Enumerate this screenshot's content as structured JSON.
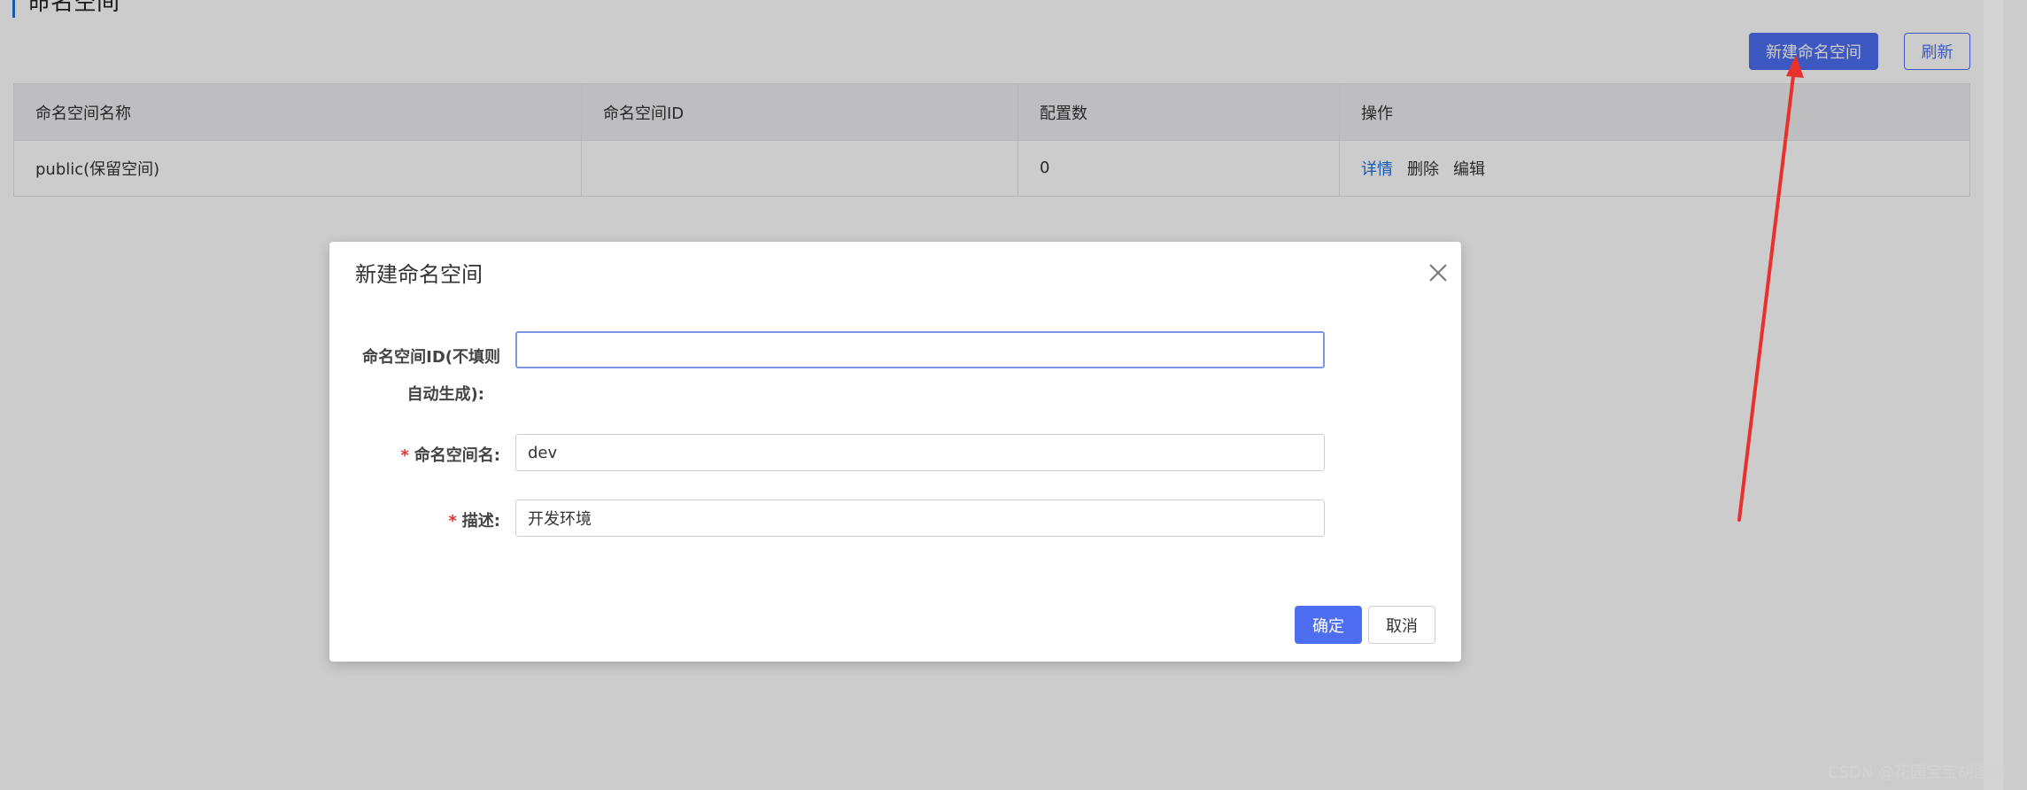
{
  "page": {
    "title": "命名空间",
    "new_namespace_button": "新建命名空间",
    "refresh_button": "刷新"
  },
  "table": {
    "columns": [
      "命名空间名称",
      "命名空间ID",
      "配置数",
      "操作"
    ],
    "rows": [
      {
        "name": "public(保留空间)",
        "id": "",
        "config_count": "0",
        "actions": [
          "详情",
          "删除",
          "编辑"
        ]
      }
    ]
  },
  "modal": {
    "title": "新建命名空间",
    "fields": [
      {
        "label_line1": "命名空间ID(不填则",
        "label_line2": "自动生成):",
        "value": "",
        "required": false
      },
      {
        "label": "命名空间名:",
        "value": "dev",
        "required": true
      },
      {
        "label": "描述:",
        "value": "开发环境",
        "required": true
      }
    ],
    "required_mark": "*",
    "confirm_button": "确定",
    "cancel_button": "取消",
    "close_icon": "close-icon"
  },
  "watermark": "CSDN @花园宝宝胡图图",
  "colors": {
    "primary": "#4e6ef2",
    "link": "#1e6fd9",
    "required": "#e5302b",
    "arrow": "#e8302c"
  }
}
